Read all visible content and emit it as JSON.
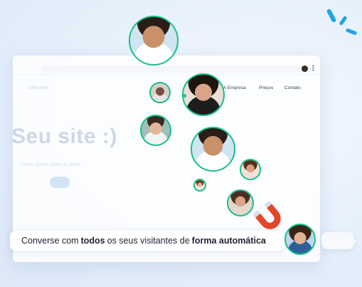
{
  "colors": {
    "accent_green": "#18c087",
    "brand_blue": "#1fa3e8",
    "magnet_red": "#e2462b"
  },
  "browser": {
    "nav_items": [
      "A Empresa",
      "Preços",
      "Contato"
    ]
  },
  "hero": {
    "headline": "Seu site :)",
    "subtext": "Lorem ipsum dolor sit amet."
  },
  "chat_bar": {
    "text_1": "Converse com",
    "bold_1": "todos",
    "text_2": "os seus visitantes de",
    "bold_2": "forma automática"
  },
  "icons": [
    "magnet-icon",
    "sparkle-icon",
    "ellipsis-menu-icon"
  ]
}
